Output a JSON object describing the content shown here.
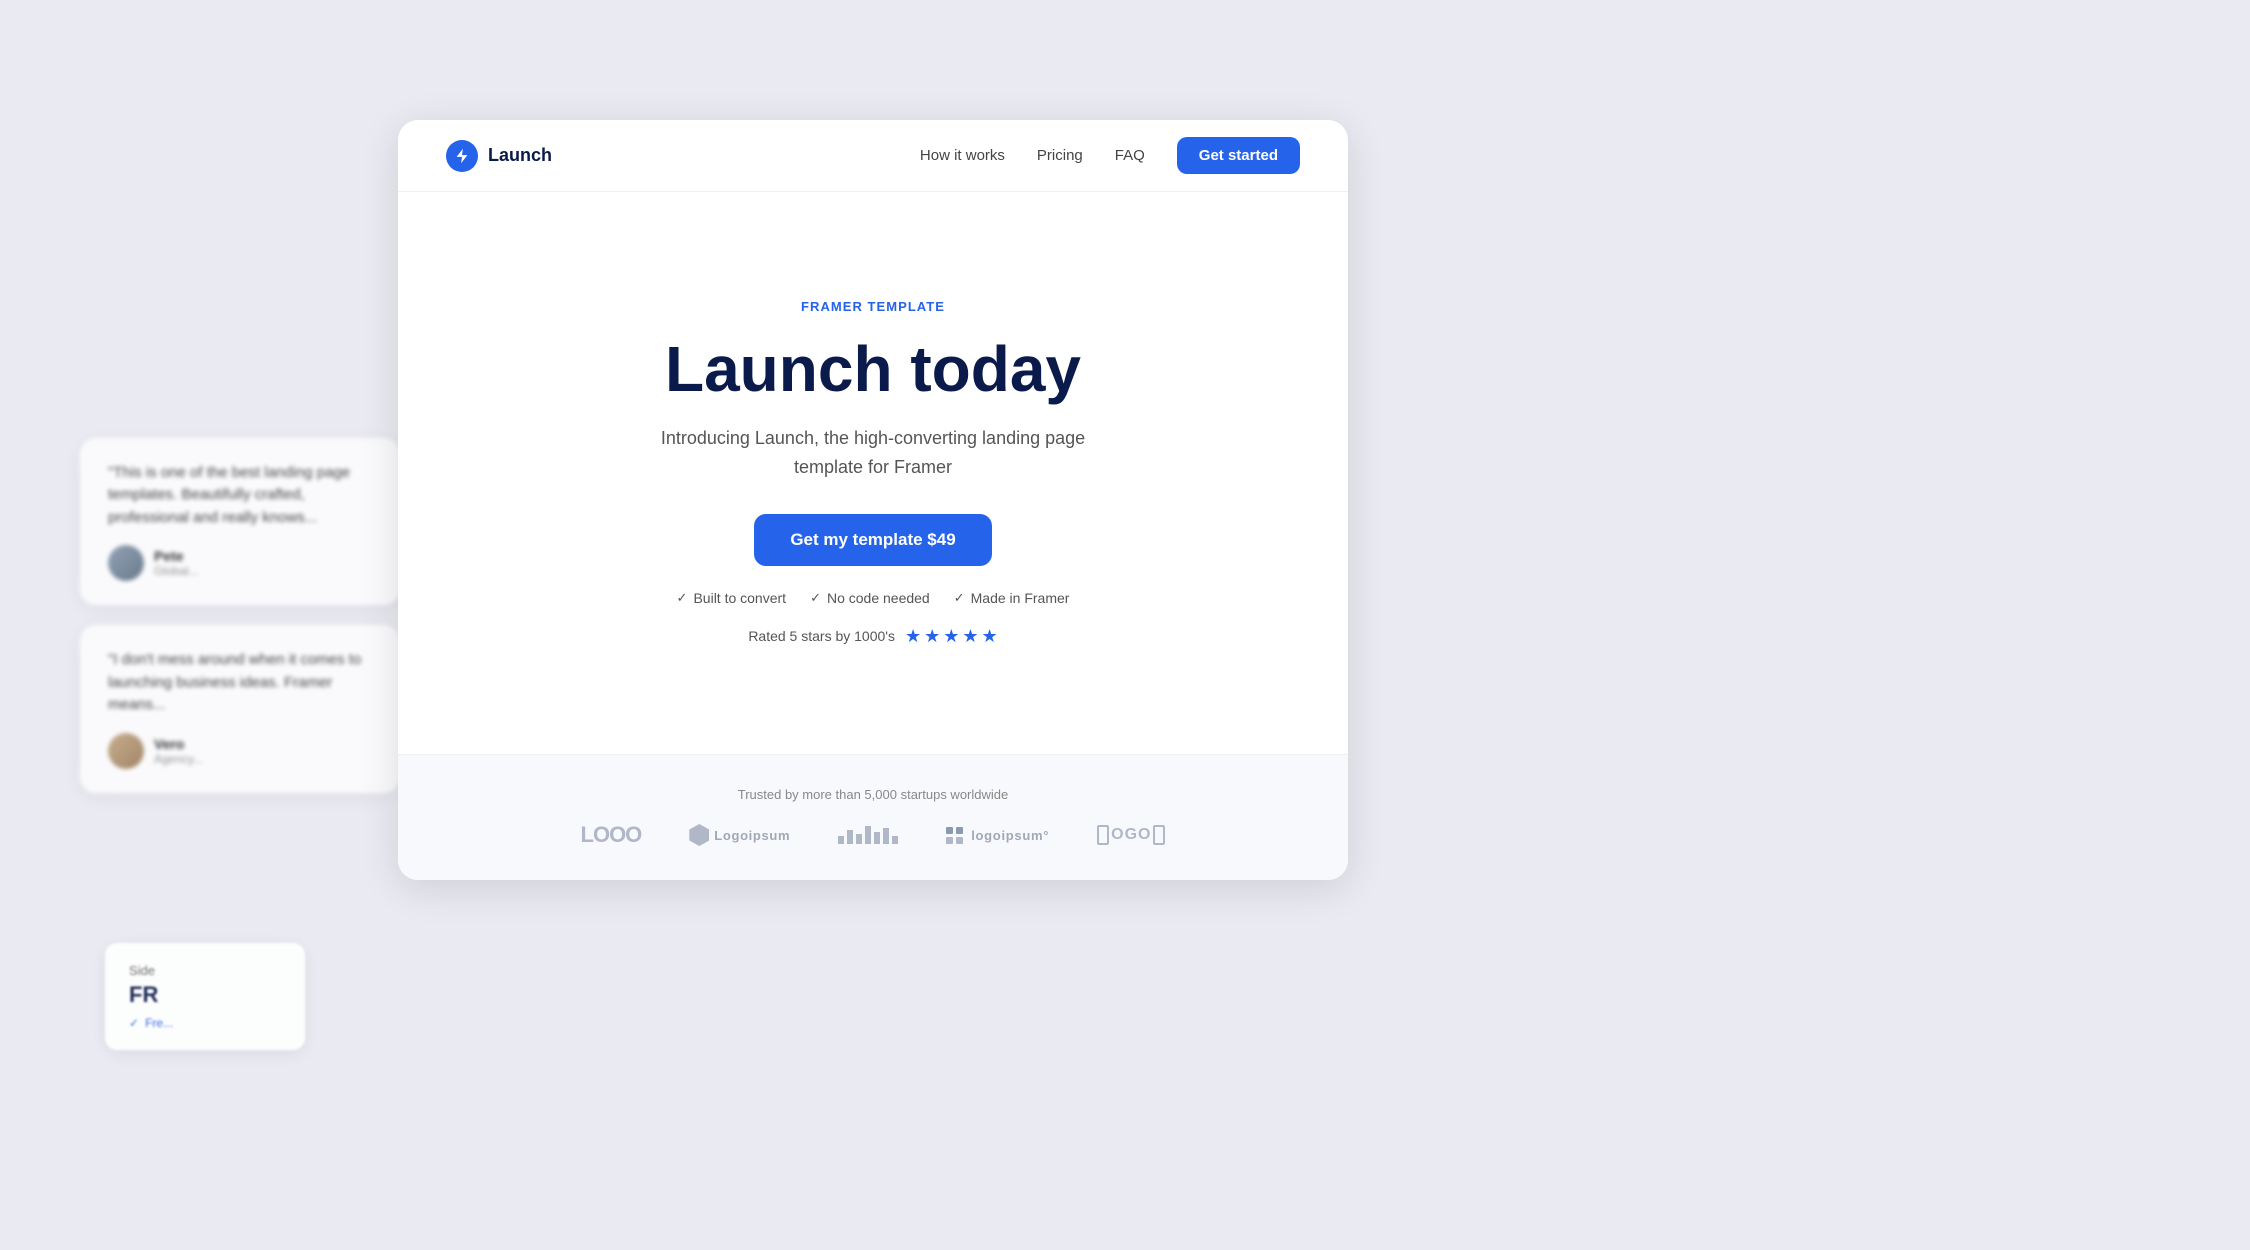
{
  "page": {
    "background_color": "#eaebf2"
  },
  "navbar": {
    "logo_text": "Launch",
    "nav_links": [
      {
        "label": "How it works",
        "id": "how-it-works"
      },
      {
        "label": "Pricing",
        "id": "pricing"
      },
      {
        "label": "FAQ",
        "id": "faq"
      }
    ],
    "cta_label": "Get started"
  },
  "hero": {
    "eyebrow": "FRAMER TEMPLATE",
    "title": "Launch today",
    "subtitle": "Introducing Launch, the high-converting landing page template for Framer",
    "cta_label": "Get my template $49",
    "features": [
      {
        "label": "Built to convert"
      },
      {
        "label": "No code needed"
      },
      {
        "label": "Made in Framer"
      }
    ],
    "rating_text": "Rated 5 stars by 1000's"
  },
  "trusted": {
    "label": "Trusted by more than 5,000 startups worldwide",
    "logos": [
      {
        "name": "LOOO",
        "type": "text"
      },
      {
        "name": "Logoipsum",
        "type": "shield"
      },
      {
        "name": "bars",
        "type": "bars"
      },
      {
        "name": "logoipsum",
        "type": "dots"
      },
      {
        "name": "BOGO",
        "type": "bracket"
      }
    ]
  },
  "testimonials": [
    {
      "quote": "\"This is one of the best landing page templates. Beautifully crafted, professional and really knows...",
      "name": "Pete",
      "role": "Global..."
    },
    {
      "quote": "\"I don't mess around when it comes to launching business ideas. Framer means...",
      "name": "Vero",
      "role": "Agency..."
    }
  ],
  "bottom_card": {
    "label": "Side",
    "title": "FR",
    "badge": "Fre..."
  }
}
